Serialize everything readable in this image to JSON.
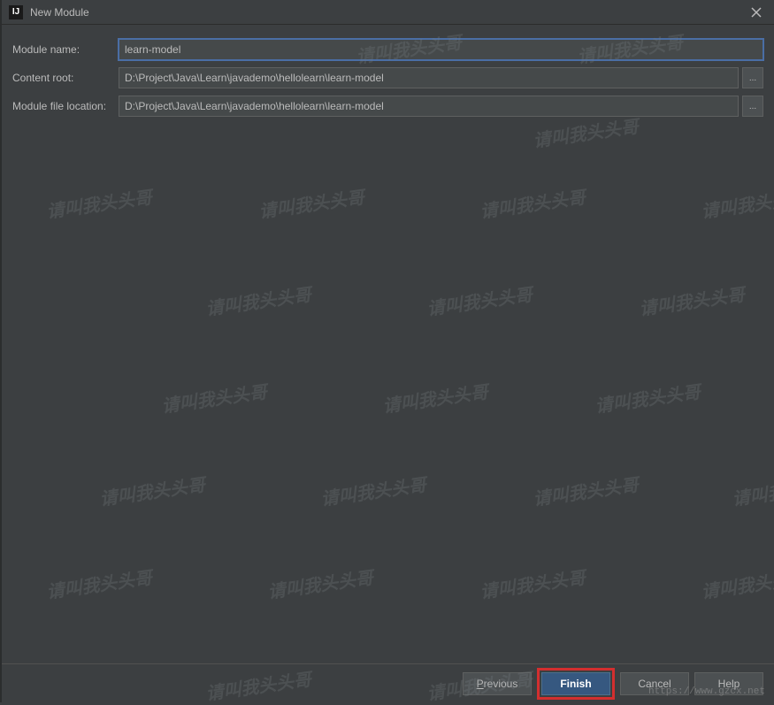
{
  "window": {
    "title": "New Module",
    "app_icon": "IJ"
  },
  "form": {
    "module_name_label": "Module name:",
    "module_name_value": "learn-model",
    "content_root_label": "Content root:",
    "content_root_value": "D:\\Project\\Java\\Learn\\javademo\\hellolearn\\learn-model",
    "module_file_location_label": "Module file location:",
    "module_file_location_value": "D:\\Project\\Java\\Learn\\javademo\\hellolearn\\learn-model",
    "browse_label": "..."
  },
  "buttons": {
    "previous": "Previous",
    "finish": "Finish",
    "cancel": "Cancel",
    "help": "Help"
  },
  "watermark_text": "请叫我头头哥",
  "footer_url": "https://www.gzcx.net"
}
